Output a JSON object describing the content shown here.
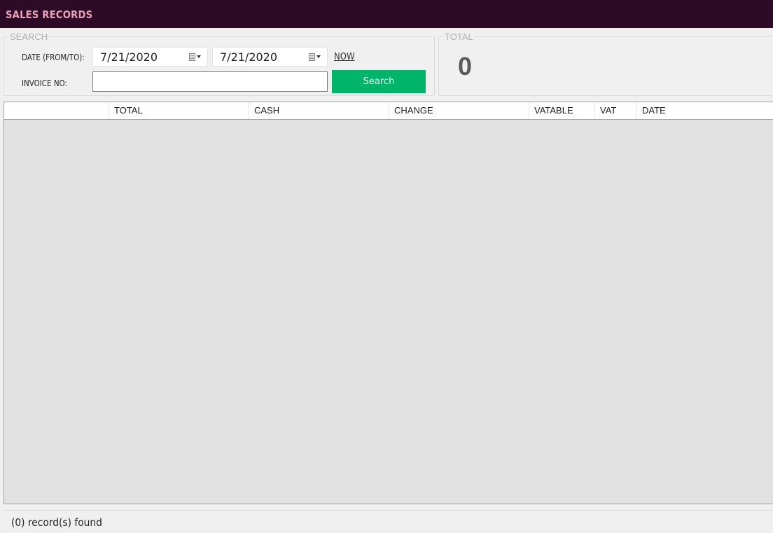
{
  "window": {
    "title": "SALES RECORDS",
    "title_color": "#2d0a25"
  },
  "search": {
    "legend": "SEARCH",
    "date_label": "DATE (FROM/TO):",
    "date_from": "7/21/2020",
    "date_to": "7/21/2020",
    "now_link": "NOW",
    "invoice_label": "INVOICE NO:",
    "invoice_value": "",
    "search_button": "Search",
    "search_button_color": "#00b56a"
  },
  "total": {
    "legend": "TOTAL",
    "value": "0"
  },
  "grid": {
    "columns": [
      "",
      "TOTAL",
      "CASH",
      "CHANGE",
      "VATABLE",
      "VAT",
      "DATE"
    ],
    "rows": []
  },
  "status": {
    "text": "(0) record(s) found"
  }
}
